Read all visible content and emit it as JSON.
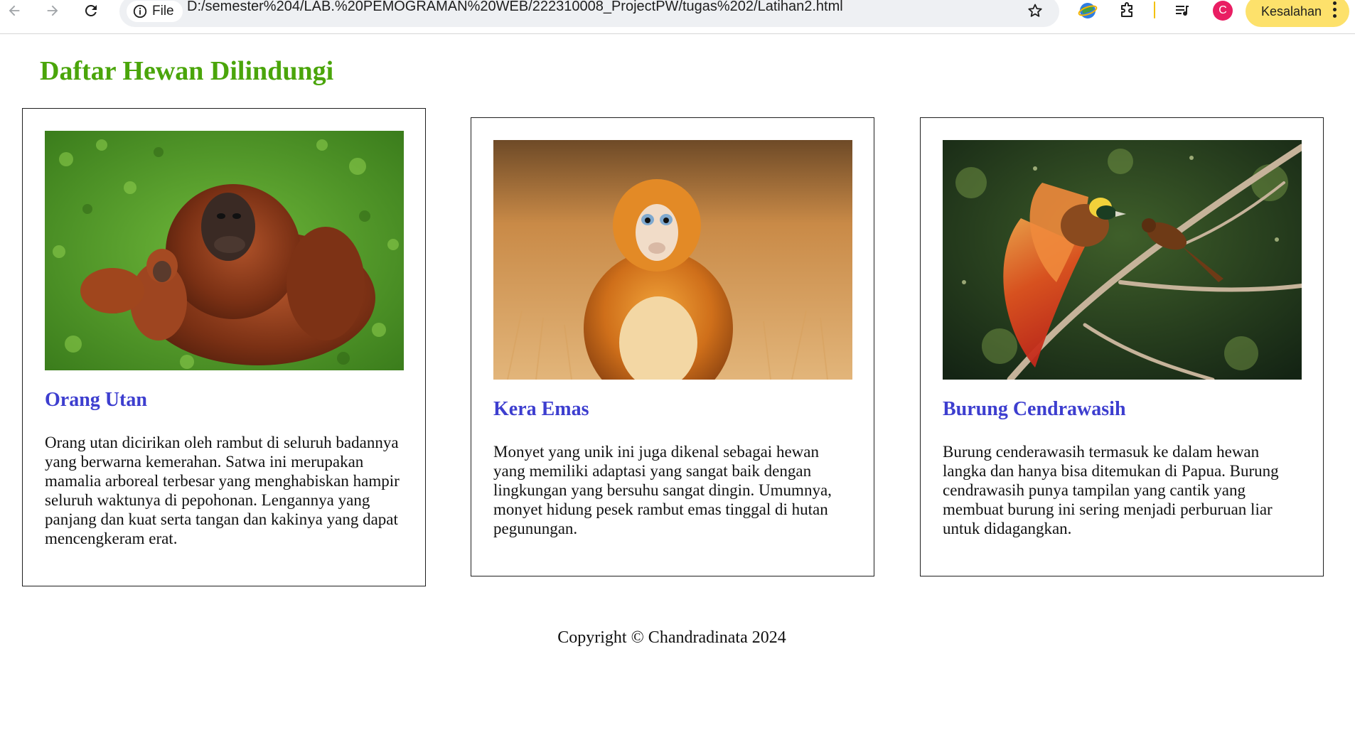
{
  "browser": {
    "site_label": "File",
    "url": "D:/semester%204/LAB.%20PEMOGRAMAN%20WEB/222310008_ProjectPW/tugas%202/Latihan2.html",
    "profile_initial": "C",
    "error_label": "Kesalahan",
    "icons": [
      "back-icon",
      "forward-icon",
      "reload-icon",
      "info-icon",
      "bookmark-star-icon",
      "extension-globe-icon",
      "extensions-puzzle-icon",
      "media-queue-icon",
      "more-vert-icon"
    ],
    "colors": {
      "error_chip": "#fde16b",
      "avatar": "#e91e63",
      "omnibox": "#eef0f3"
    }
  },
  "page": {
    "title": "Daftar Hewan Dilindungi",
    "title_color": "#4aa50a",
    "card_title_color": "#3d3ecf",
    "cards": [
      {
        "title": "Orang Utan",
        "image": "orangutan-mother-and-baby-photo",
        "description": "Orang utan dicirikan oleh rambut di seluruh badannya yang berwarna kemerahan. Satwa ini merupakan mamalia arboreal terbesar yang menghabiskan hampir seluruh waktunya di pepohonan. Lengannya yang panjang dan kuat serta tangan dan kakinya yang dapat mencengkeram erat."
      },
      {
        "title": "Kera Emas",
        "image": "golden-snub-nosed-monkey-photo",
        "description": "Monyet yang unik ini juga dikenal sebagai hewan yang memiliki adaptasi yang sangat baik dengan lingkungan yang bersuhu sangat dingin. Umumnya, monyet hidung pesek rambut emas tinggal di hutan pegunungan."
      },
      {
        "title": "Burung Cendrawasih",
        "image": "bird-of-paradise-on-branch-photo",
        "description": "Burung cenderawasih termasuk ke dalam hewan langka dan hanya bisa ditemukan di Papua. Burung cendrawasih punya tampilan yang cantik yang membuat burung ini sering menjadi perburuan liar untuk didagangkan."
      }
    ],
    "footer": "Copyright © Chandradinata 2024"
  }
}
